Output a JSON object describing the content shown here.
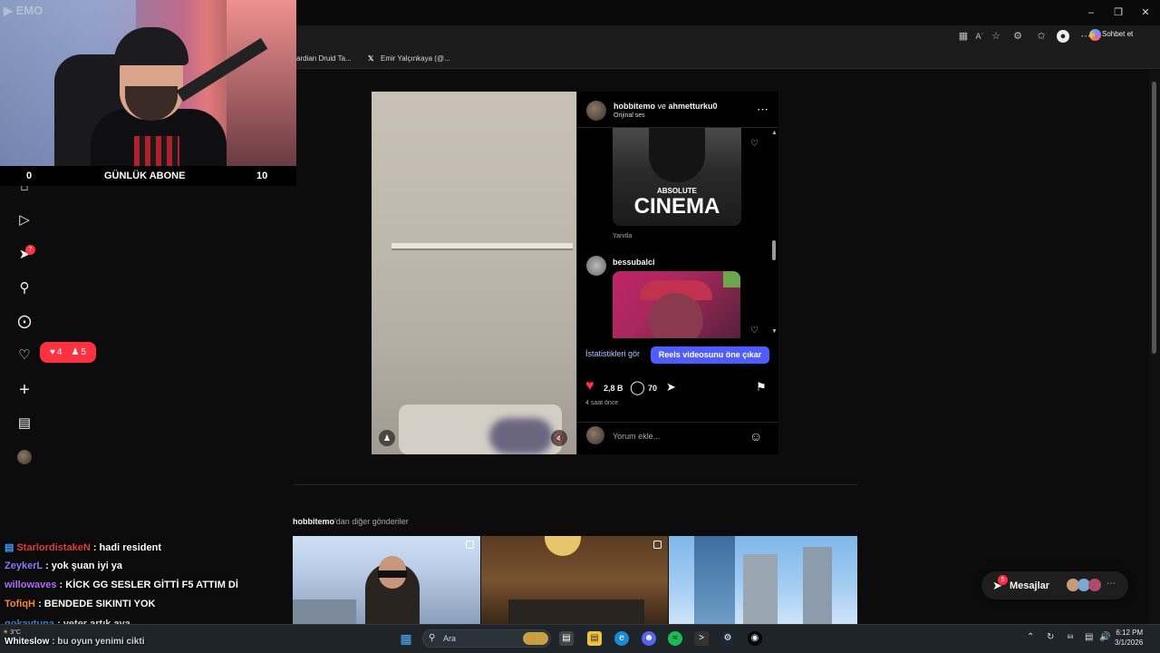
{
  "browser": {
    "favorites": [
      "ardian Druid Ta...",
      "Emir Yalçınkaya (@..."
    ],
    "copilot_label": "Sohbet et"
  },
  "stream": {
    "watermark": "EMO",
    "abone": {
      "left": "0",
      "label": "GÜNLÜK ABONE",
      "right": "10"
    },
    "chat": [
      {
        "user": "StarlordistakeN",
        "color": "#e83b3b",
        "text": " : hadi resident"
      },
      {
        "user": "ZeykerL",
        "color": "#8a7cff",
        "text": " : yok şuan iyi ya"
      },
      {
        "user": "willowaves",
        "color": "#b46cff",
        "text": " : KİCK GG SESLER GİTTİ F5 ATTIM Dİ"
      },
      {
        "user": "TofiqH",
        "color": "#ff8a2a",
        "text": " : BENDEDE SIKINTI YOK"
      },
      {
        "user": "gokaytuna",
        "color": "#3fa0ff",
        "text": " : yeter artık aya"
      },
      {
        "user": "Whiteslow",
        "color": "#ffffff",
        "text": " : bu oyun yenimi cikti"
      }
    ]
  },
  "nav": {
    "notification_badge": "7",
    "likes_count": "4",
    "follows_count": "5"
  },
  "post": {
    "author": "hobbitemo",
    "connector": " ve ",
    "coauthor": "ahmetturku0",
    "audio": "Orijinal ses",
    "gif_caption_top": "ABSOLUTE",
    "gif_caption_main": "CINEMA",
    "reply_label": "Yanıtla",
    "commenter": "bessubalci",
    "stats_link": "İstatistikleri gör",
    "boost_button": "Reels videosunu öne çıkar",
    "likes": "2,8 B",
    "comments": "70",
    "time_ago": "4 saat önce",
    "comment_placeholder": "Yorum ekle..."
  },
  "more": {
    "user": "hobbitemo",
    "suffix": "'dan diğer gönderiler"
  },
  "messages": {
    "label": "Mesajlar",
    "badge": "5"
  },
  "taskbar": {
    "search_placeholder": "Ara",
    "time": "6:12 PM",
    "date": "3/1/2026",
    "weather": "3°C"
  },
  "colors": {
    "accent_blue": "#4f5dff",
    "like_red": "#ff3040"
  }
}
